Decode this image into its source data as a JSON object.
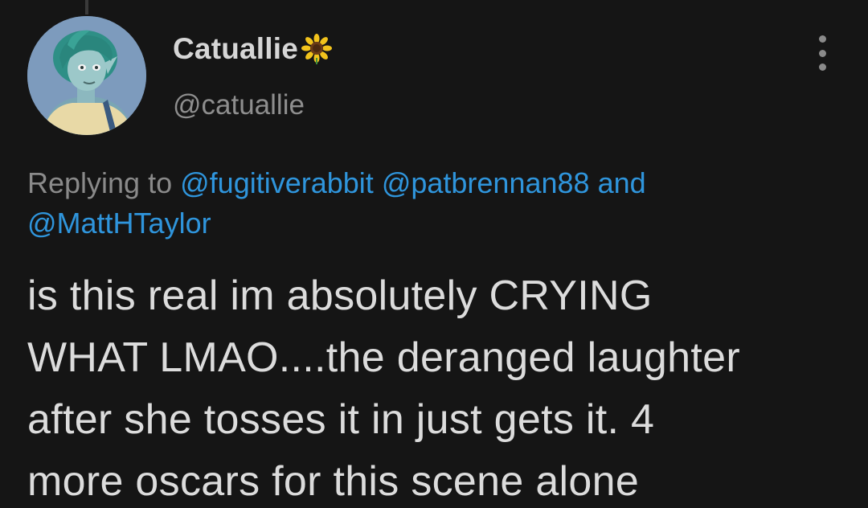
{
  "tweet": {
    "author": {
      "display_name": "Catuallie",
      "name_emoji_icon": "sunflower-icon",
      "handle": "@catuallie",
      "avatar_icon": "avatar-illustration"
    },
    "menu_icon": "more-vertical-icon",
    "reply_context": {
      "prefix": "Replying to",
      "mentions": [
        "@fugitiverabbit",
        "@patbrennan88",
        "@MattHTaylor"
      ],
      "conjunction": "and"
    },
    "text_lines": [
      "is this real im absolutely CRYING",
      "WHAT LMAO....the deranged laughter",
      "after she tosses it in just gets it. 4",
      "more oscars for this scene alone"
    ]
  },
  "colors": {
    "background": "#151515",
    "mention": "#2f95dc",
    "secondary_text": "#8a8a8a",
    "primary_text": "#dcdcdc"
  }
}
